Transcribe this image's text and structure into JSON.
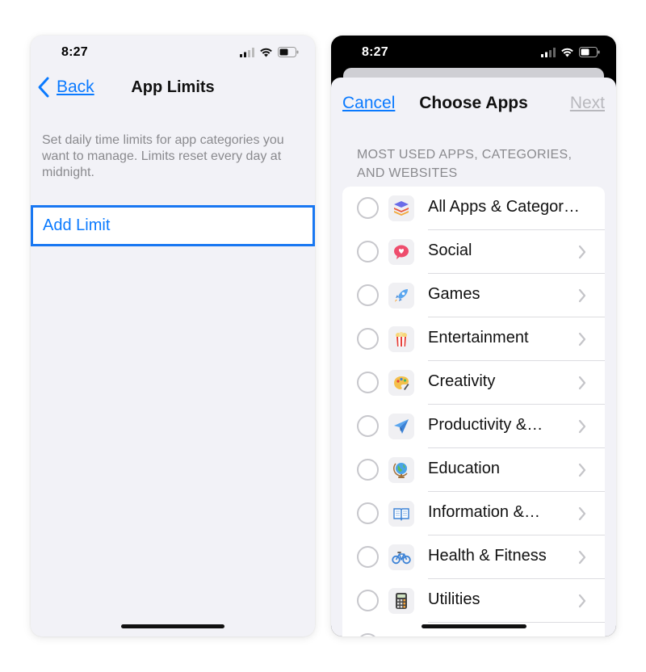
{
  "left_screen": {
    "status_time": "8:27",
    "back_label": "Back",
    "title": "App Limits",
    "description": "Set daily time limits for app categories you want to manage. Limits reset every day at midnight.",
    "add_limit_label": "Add Limit"
  },
  "right_screen": {
    "status_time": "8:27",
    "cancel_label": "Cancel",
    "title": "Choose Apps",
    "next_label": "Next",
    "section_header": "MOST USED APPS, CATEGORIES, AND WEBSITES",
    "rows": [
      {
        "label": "All Apps & Categor…",
        "icon": "stack-icon",
        "has_chevron": false
      },
      {
        "label": "Social",
        "icon": "chat-bubble-heart-icon",
        "has_chevron": true
      },
      {
        "label": "Games",
        "icon": "rocket-icon",
        "has_chevron": true
      },
      {
        "label": "Entertainment",
        "icon": "popcorn-icon",
        "has_chevron": true
      },
      {
        "label": "Creativity",
        "icon": "palette-icon",
        "has_chevron": true
      },
      {
        "label": "Productivity &…",
        "icon": "paper-plane-icon",
        "has_chevron": true
      },
      {
        "label": "Education",
        "icon": "globe-icon",
        "has_chevron": true
      },
      {
        "label": "Information &…",
        "icon": "book-icon",
        "has_chevron": true
      },
      {
        "label": "Health & Fitness",
        "icon": "bicycle-icon",
        "has_chevron": true
      },
      {
        "label": "Utilities",
        "icon": "calculator-icon",
        "has_chevron": true
      }
    ]
  },
  "colors": {
    "accent": "#0a7aff",
    "highlight_border": "#1877f2",
    "background": "#f2f2f7",
    "disabled_text": "#b8b8bd"
  }
}
